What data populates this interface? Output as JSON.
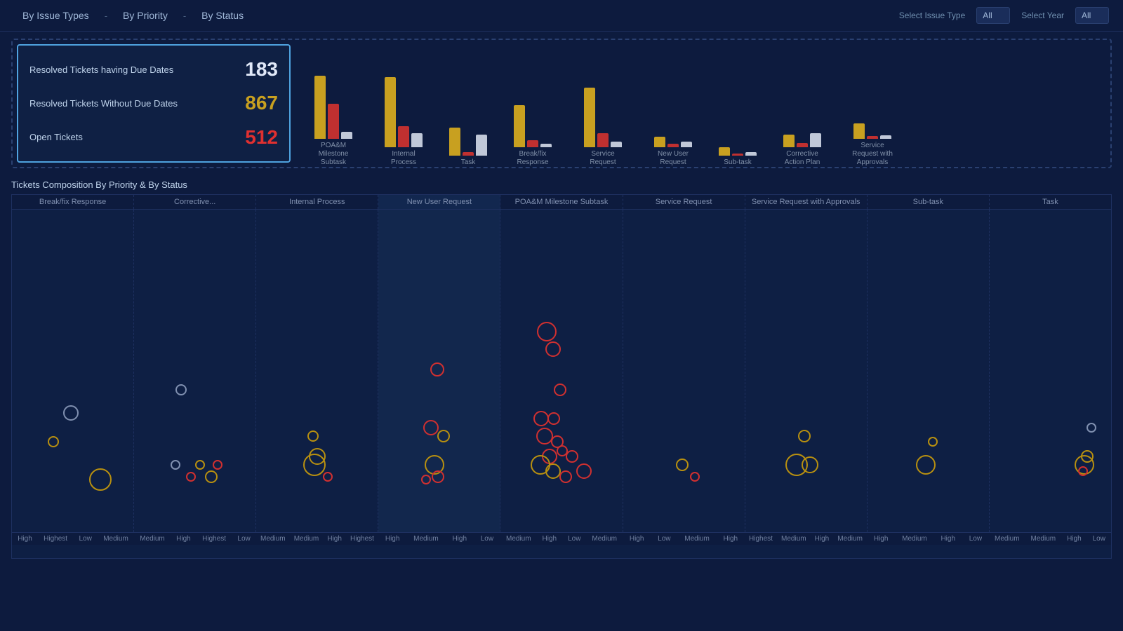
{
  "nav": {
    "tabs": [
      {
        "label": "By Issue Types",
        "active": false
      },
      {
        "label": "By Priority",
        "active": false
      },
      {
        "label": "By Status",
        "active": false
      }
    ],
    "filters": [
      {
        "label": "Select Issue Type",
        "value": "All"
      },
      {
        "label": "Select Year",
        "value": "All"
      }
    ]
  },
  "summary": {
    "rows": [
      {
        "label": "Resolved Tickets having Due Dates",
        "value": "183",
        "colorClass": "val-white"
      },
      {
        "label": "Resolved Tickets Without Due Dates",
        "value": "867",
        "colorClass": "val-gold"
      },
      {
        "label": "Open Tickets",
        "value": "512",
        "colorClass": "val-red"
      }
    ]
  },
  "barChart": {
    "groups": [
      {
        "label": "POA&M Milestone Subtask",
        "gold": 90,
        "red": 50,
        "white": 10
      },
      {
        "label": "Internal Process",
        "gold": 100,
        "red": 30,
        "white": 20
      },
      {
        "label": "Task",
        "gold": 40,
        "red": 5,
        "white": 30
      },
      {
        "label": "Break/fix Response",
        "gold": 60,
        "red": 10,
        "white": 5
      },
      {
        "label": "Service Request",
        "gold": 85,
        "red": 20,
        "white": 8
      },
      {
        "label": "New User Request",
        "gold": 15,
        "red": 5,
        "white": 8
      },
      {
        "label": "Sub-task",
        "gold": 12,
        "red": 3,
        "white": 5
      },
      {
        "label": "Corrective Action Plan",
        "gold": 18,
        "red": 6,
        "white": 20
      },
      {
        "label": "Service Request with Approvals",
        "gold": 22,
        "red": 4,
        "white": 5
      }
    ]
  },
  "scatter": {
    "title": "Tickets Composition By Priority & By Status",
    "columns": [
      {
        "label": "Break/fix Response"
      },
      {
        "label": "Corrective..."
      },
      {
        "label": "Internal Process"
      },
      {
        "label": "New User Request"
      },
      {
        "label": "POA&M Milestone Subtask"
      },
      {
        "label": "Service Request"
      },
      {
        "label": "Service Request with Approvals"
      },
      {
        "label": "Sub-task"
      },
      {
        "label": "Task"
      }
    ],
    "xLabels": [
      [
        "High",
        "Highest",
        "Low",
        "Medium"
      ],
      [
        "Medium",
        "High",
        "Highest",
        "Low"
      ],
      [
        "Medium",
        "Medium",
        "High",
        "Highest"
      ],
      [
        "High",
        "Medium",
        "High",
        "Low"
      ],
      [
        "Medium",
        "High",
        "Low",
        "Medium"
      ],
      [
        "High",
        "Low",
        "Medium",
        "High"
      ],
      [
        "Highest",
        "Medium",
        "High",
        "Medium"
      ],
      [
        "High",
        "Medium",
        "High",
        "Low"
      ],
      [
        "Medium",
        "Medium",
        "High",
        "Low"
      ]
    ]
  }
}
